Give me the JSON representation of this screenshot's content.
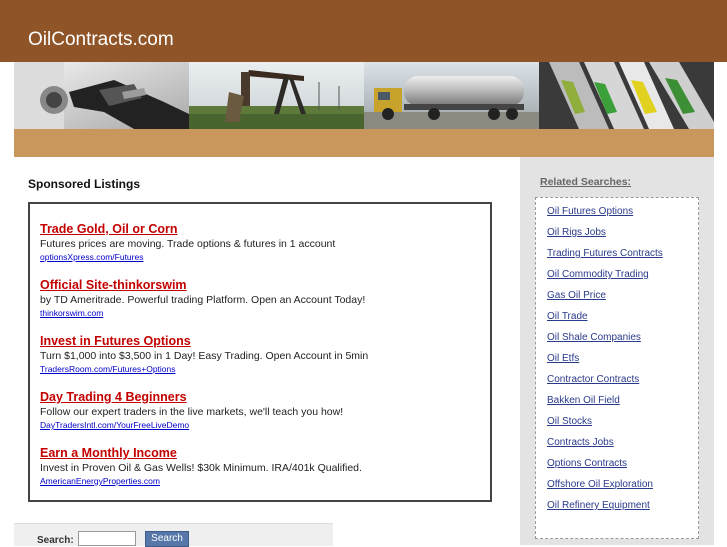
{
  "header": {
    "title": "OilContracts.com"
  },
  "banner": {
    "images": [
      "fuel-nozzle-image",
      "oil-pumpjack-image",
      "tanker-truck-image",
      "gas-pumps-image"
    ]
  },
  "sponsored": {
    "title": "Sponsored Listings",
    "ads": [
      {
        "title": "Trade Gold, Oil or Corn",
        "description": "Futures prices are moving. Trade options & futures in 1 account",
        "url": "optionsXpress.com/Futures"
      },
      {
        "title": "Official Site-thinkorswim",
        "description": "by TD Ameritrade. Powerful trading Platform. Open an Account Today!",
        "url": "thinkorswim.com"
      },
      {
        "title": "Invest in Futures Options",
        "description": "Turn $1,000 into $3,500 in 1 Day! Easy Trading. Open Account in 5min",
        "url": "TradersRoom.com/Futures+Options"
      },
      {
        "title": "Day Trading 4 Beginners",
        "description": "Follow our expert traders in the live markets, we'll teach you how!",
        "url": "DayTradersIntl.com/YourFreeLiveDemo"
      },
      {
        "title": "Earn a Monthly Income",
        "description": "Invest in Proven Oil & Gas Wells! $30k Minimum. IRA/401k Qualified.",
        "url": "AmericanEnergyProperties.com"
      }
    ]
  },
  "related": {
    "title": "Related Searches:",
    "items": [
      "Oil Futures Options",
      "Oil Rigs Jobs",
      "Trading Futures Contracts",
      "Oil Commodity Trading",
      "Gas Oil Price",
      "Oil Trade",
      "Oil Shale Companies",
      "Oil Etfs",
      "Contractor Contracts",
      "Bakken Oil Field",
      "Oil Stocks",
      "Contracts Jobs",
      "Options Contracts",
      "Offshore Oil Exploration",
      "Oil Refinery Equipment"
    ]
  },
  "search": {
    "label": "Search:",
    "button": "Search",
    "value": ""
  }
}
